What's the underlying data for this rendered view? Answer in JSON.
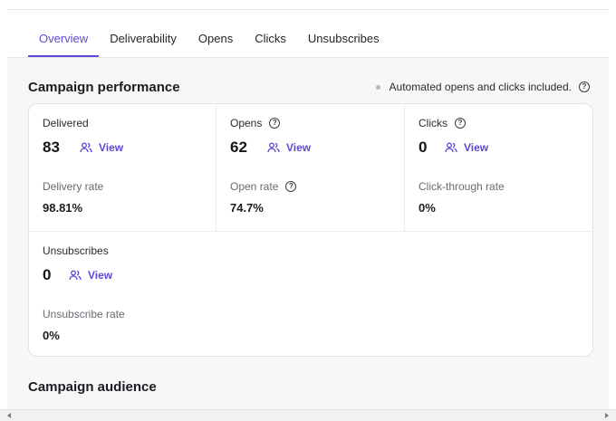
{
  "tabs": [
    {
      "label": "Overview",
      "active": true
    },
    {
      "label": "Deliverability",
      "active": false
    },
    {
      "label": "Opens",
      "active": false
    },
    {
      "label": "Clicks",
      "active": false
    },
    {
      "label": "Unsubscribes",
      "active": false
    }
  ],
  "performance": {
    "title": "Campaign performance",
    "note": "Automated opens and clicks included.",
    "metrics": [
      {
        "label": "Delivered",
        "value": "83",
        "view": "View",
        "rate_label": "Delivery rate",
        "rate": "98.81%"
      },
      {
        "label": "Opens",
        "value": "62",
        "view": "View",
        "rate_label": "Open rate",
        "rate": "74.7%"
      },
      {
        "label": "Clicks",
        "value": "0",
        "view": "View",
        "rate_label": "Click-through rate",
        "rate": "0%"
      },
      {
        "label": "Unsubscribes",
        "value": "0",
        "view": "View",
        "rate_label": "Unsubscribe rate",
        "rate": "0%"
      }
    ]
  },
  "audience": {
    "title": "Campaign audience"
  },
  "colors": {
    "accent": "#5b49d6",
    "background": "#f7f7f7"
  },
  "icons": {
    "help": "question-circle-icon",
    "view": "users-icon"
  }
}
